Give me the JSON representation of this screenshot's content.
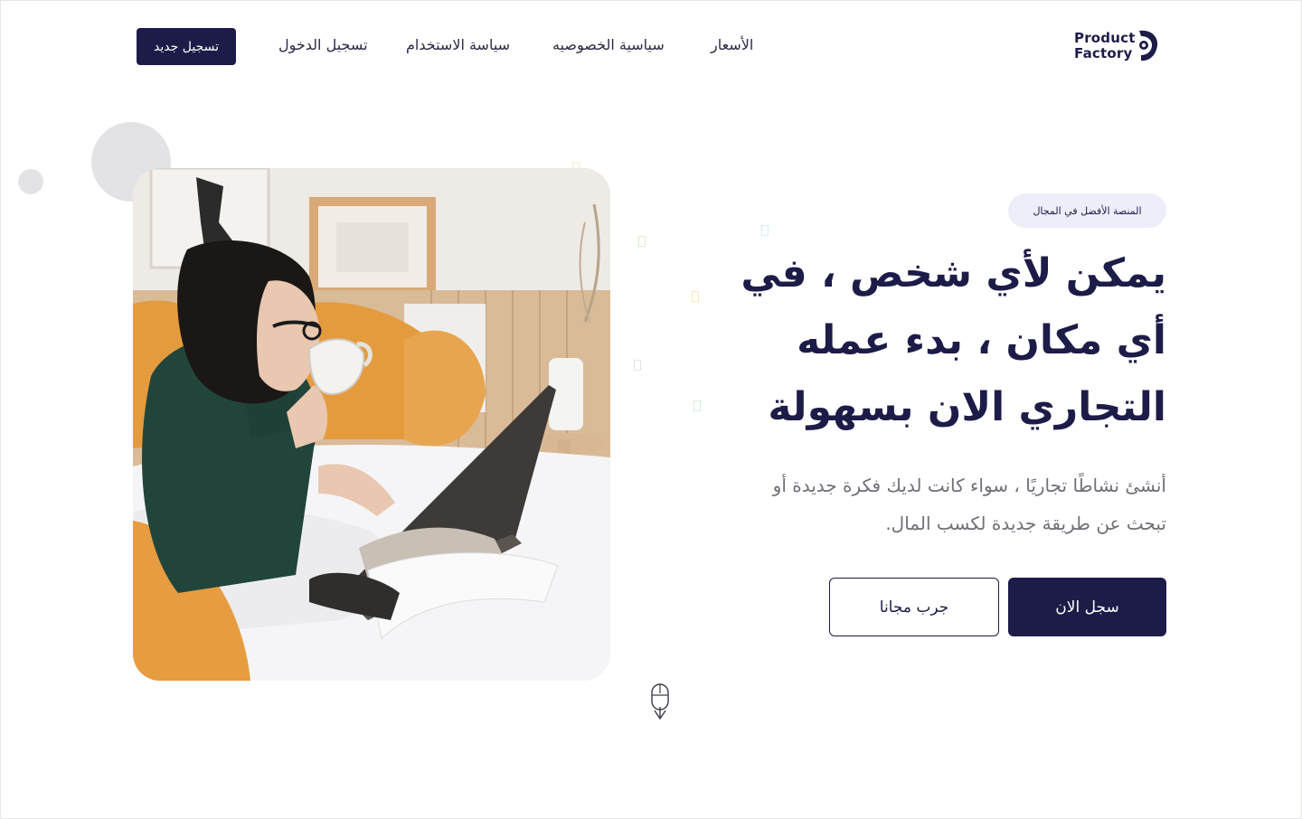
{
  "header": {
    "logo_line1": "Product",
    "logo_line2": "Factory",
    "nav": {
      "pricing": "الأسعار",
      "privacy": "سياسية الخصوصيه",
      "usage": "سياسة الاستخدام",
      "login": "تسجيل الدخول"
    },
    "register_button": "تسجيل جديد"
  },
  "hero": {
    "badge": "المنصة الأفضل في المجال",
    "title_lines": [
      "يمكن لأي شخص ، في",
      "أي مكان ، بدء عمله",
      "التجاري الان بسهولة"
    ],
    "description_lines": [
      "أنشئ نشاطًا تجاريًا ، سواء كانت لديك فكرة جديدة أو",
      ".تبحث عن طريقة جديدة لكسب المال"
    ],
    "primary_button": "سجل الان",
    "secondary_button": "جرب مجانا"
  },
  "icons": {
    "logo": "product-factory-logo-icon",
    "scroll": "mouse-scroll-icon"
  },
  "colors": {
    "brand": "#1d1c48",
    "badge_bg": "#eeeefa",
    "muted_text": "#6f6f78",
    "decor_circle": "#e3e3e6",
    "photo_accent_orange": "#e8a04a",
    "photo_accent_green": "#21453b"
  }
}
